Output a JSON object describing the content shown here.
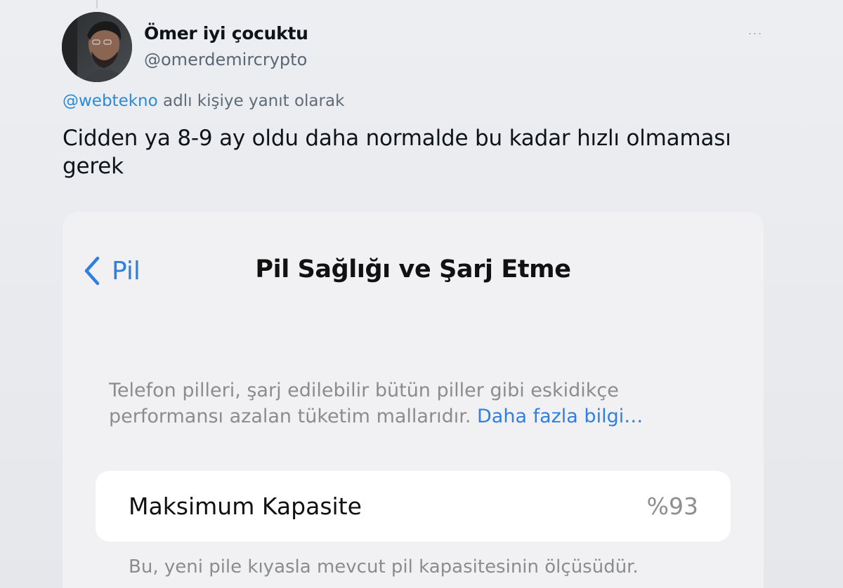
{
  "tweet": {
    "author": {
      "display_name": "Ömer iyi çocuktu",
      "handle": "@omerdemircrypto"
    },
    "more_icon": "more-dots-icon",
    "reply_to": {
      "mention": "@webtekno",
      "suffix": " adlı kişiye yanıt olarak"
    },
    "text": "Cidden ya 8-9 ay oldu daha normalde bu kadar hızlı olmaması gerek"
  },
  "screenshot": {
    "back_label": "Pil",
    "back_icon": "chevron-left-icon",
    "title": "Pil Sağlığı ve Şarj Etme",
    "info_text": "Telefon pilleri, şarj edilebilir bütün piller gibi eskidikçe performansı azalan tüketim mallarıdır. ",
    "info_link": "Daha fazla bilgi…",
    "capacity_label": "Maksimum Kapasite",
    "capacity_value": "%93",
    "footnote": "Bu, yeni pile kıyasla mevcut pil kapasitesinin ölçüsüdür."
  },
  "colors": {
    "link_blue": "#2f7fe0",
    "mention_blue": "#2a8ad8",
    "text_dark": "#0f1419",
    "secondary_gray": "#8b8c90"
  }
}
